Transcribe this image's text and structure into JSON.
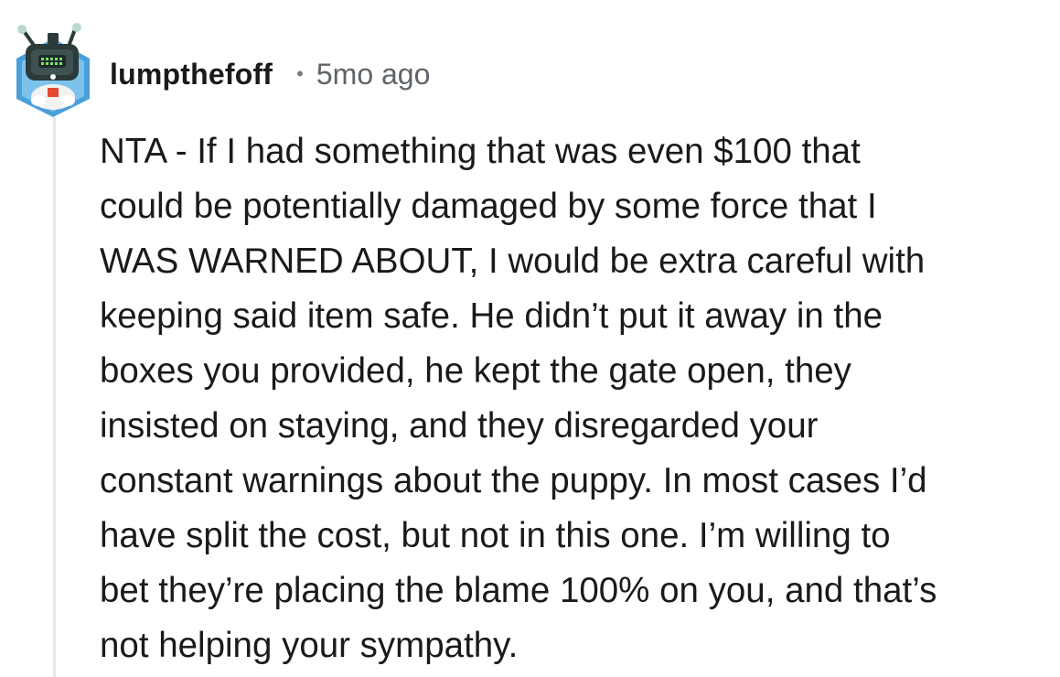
{
  "comment": {
    "author": "lumpthefoff",
    "separator": "•",
    "age": "5mo ago",
    "avatar_icon": "snoo-avatar-icon",
    "body_lines": [
      "NTA - If I had something that was even $100 that",
      "could be potentially damaged by some force that I",
      "WAS WARNED ABOUT, I would be extra careful with",
      "keeping said item safe. He didn’t put it away in the",
      "boxes you provided, he kept the gate open, they",
      "insisted on staying, and they disregarded your",
      "constant warnings about the puppy. In most cases I’d",
      "have split the cost, but not in this one. I’m willing to",
      "bet they’re placing the blame 100% on you, and that’s",
      "not helping your sympathy."
    ]
  },
  "colors": {
    "text": "#1a1a1b",
    "meta": "#5f6469",
    "thread_line": "#e5e7ea",
    "avatar_bg": "#4a9fd8"
  }
}
